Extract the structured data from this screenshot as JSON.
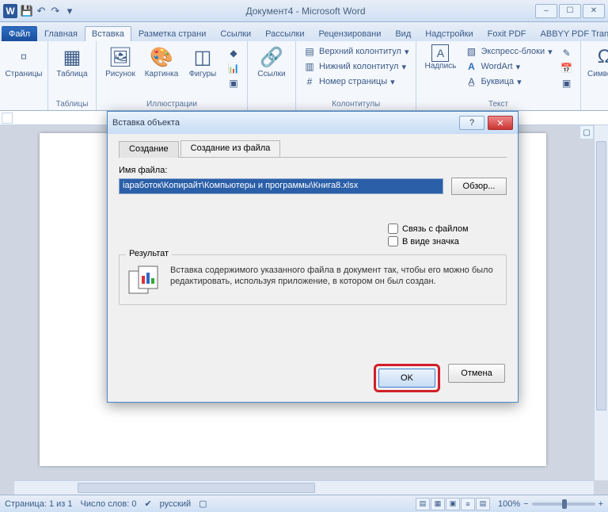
{
  "title": "Документ4 - Microsoft Word",
  "tabs": {
    "file": "Файл",
    "home": "Главная",
    "insert": "Вставка",
    "layout": "Разметка страни",
    "refs": "Ссылки",
    "mail": "Рассылки",
    "review": "Рецензировани",
    "view": "Вид",
    "addins": "Надстройки",
    "foxit": "Foxit PDF",
    "abbyy": "ABBYY PDF Trans"
  },
  "ribbon": {
    "pages": {
      "label": "Страницы",
      "group": ""
    },
    "tables": {
      "label": "Таблица",
      "group": "Таблицы"
    },
    "illus": {
      "pic": "Рисунок",
      "clip": "Картинка",
      "shapes": "Фигуры",
      "group": "Иллюстрации"
    },
    "links": {
      "label": "Ссылки"
    },
    "hf": {
      "header": "Верхний колонтитул",
      "footer": "Нижний колонтитул",
      "page": "Номер страницы",
      "group": "Колонтитулы"
    },
    "textbox": {
      "label": "Надпись"
    },
    "text": {
      "quick": "Экспресс-блоки",
      "wordart": "WordArt",
      "drop": "Буквица",
      "group": "Текст"
    },
    "symbols": {
      "label": "Символы"
    }
  },
  "dialog": {
    "title": "Вставка объекта",
    "tab1": "Создание",
    "tab2": "Создание из файла",
    "filelabel": "Имя файла:",
    "filepath": "іаработок\\Копирайт\\Компьютеры и программы\\Книга8.xlsx",
    "browse": "Обзор...",
    "linkfile": "Связь с файлом",
    "asicon": "В виде значка",
    "resultlabel": "Результат",
    "resulttext": "Вставка содержимого указанного файла в документ так, чтобы его можно было редактировать, используя приложение, в котором он был создан.",
    "ok": "OK",
    "cancel": "Отмена"
  },
  "status": {
    "page": "Страница: 1 из 1",
    "words": "Число слов: 0",
    "lang": "русский",
    "zoom": "100%"
  }
}
